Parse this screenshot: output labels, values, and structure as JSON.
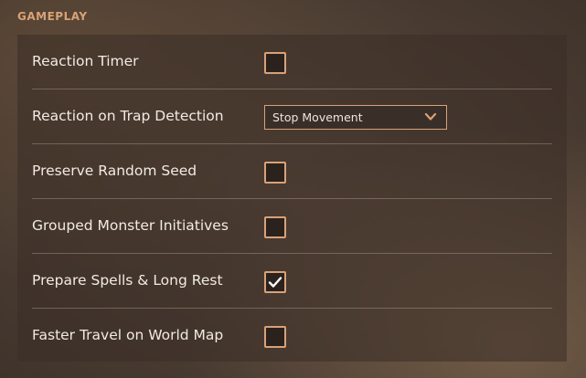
{
  "section": {
    "title": "GAMEPLAY"
  },
  "settings": [
    {
      "label": "Reaction Timer",
      "type": "checkbox",
      "checked": false
    },
    {
      "label": "Reaction on Trap Detection",
      "type": "dropdown",
      "value": "Stop Movement"
    },
    {
      "label": "Preserve Random Seed",
      "type": "checkbox",
      "checked": false
    },
    {
      "label": "Grouped Monster Initiatives",
      "type": "checkbox",
      "checked": false
    },
    {
      "label": "Prepare Spells & Long Rest",
      "type": "checkbox",
      "checked": true
    },
    {
      "label": "Faster Travel on World Map",
      "type": "checkbox",
      "checked": false
    }
  ],
  "colors": {
    "accent": "#d9a17a",
    "header": "#d8a276",
    "text": "#f2ebe3"
  },
  "icons": {
    "check": "check-icon",
    "dropdown": "chevron-down-icon"
  }
}
